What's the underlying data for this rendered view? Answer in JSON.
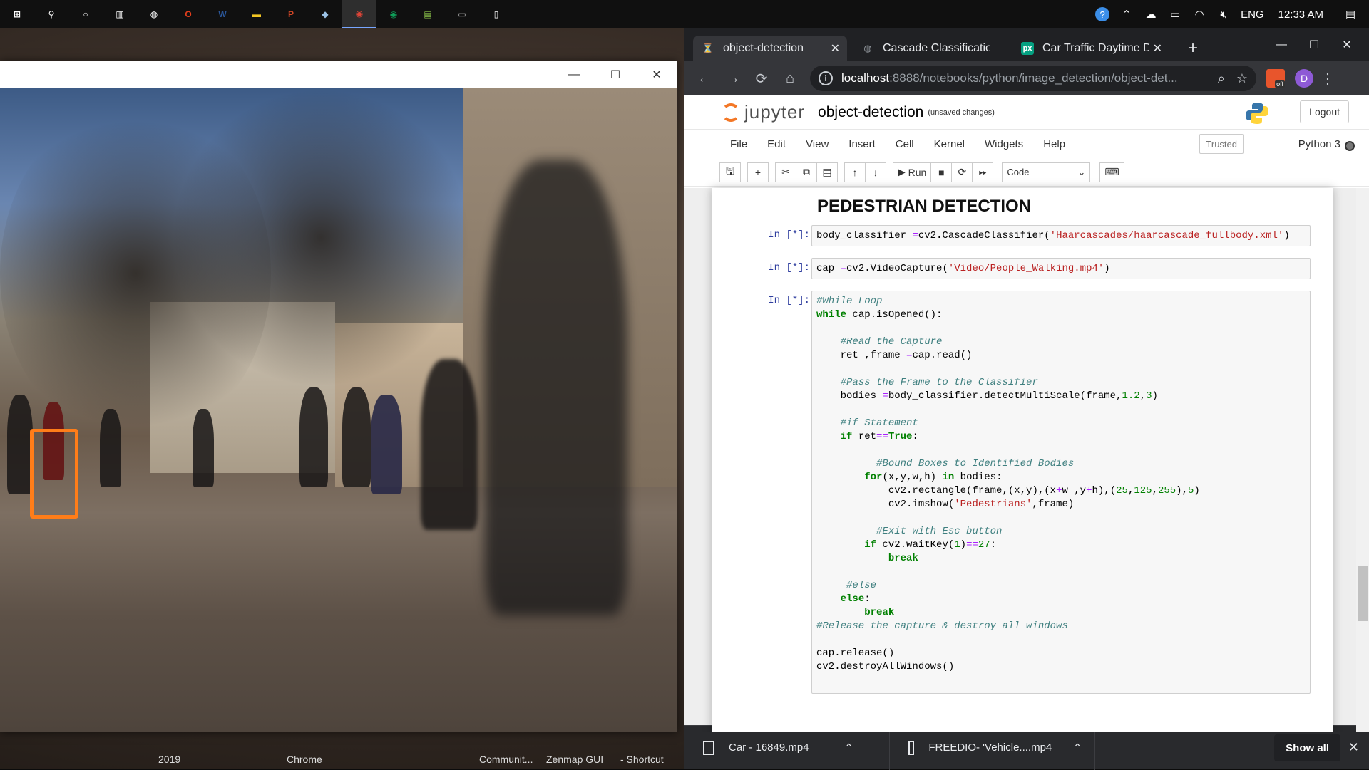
{
  "taskbar": {
    "apps": [
      {
        "name": "start",
        "glyph": "⊞",
        "color": "#ffffff"
      },
      {
        "name": "search",
        "glyph": "⚲",
        "color": "#ffffff"
      },
      {
        "name": "cortana",
        "glyph": "○",
        "color": "#ffffff"
      },
      {
        "name": "task-view",
        "glyph": "▥",
        "color": "#ffffff"
      },
      {
        "name": "app-mail",
        "glyph": "◍",
        "color": "#ffffff"
      },
      {
        "name": "office",
        "glyph": "O",
        "color": "#e43e1c"
      },
      {
        "name": "word",
        "glyph": "W",
        "color": "#2b579a"
      },
      {
        "name": "file-explorer",
        "glyph": "▬",
        "color": "#f3c623"
      },
      {
        "name": "powerpoint",
        "glyph": "P",
        "color": "#d24726"
      },
      {
        "name": "notes",
        "glyph": "◆",
        "color": "#9cc3e6"
      },
      {
        "name": "chrome",
        "glyph": "◉",
        "color": "#db4437"
      },
      {
        "name": "chrome-2",
        "glyph": "◉",
        "color": "#0f9d58"
      },
      {
        "name": "notepad-plus",
        "glyph": "▤",
        "color": "#8bc34a"
      },
      {
        "name": "terminal",
        "glyph": "▭",
        "color": "#d0d0d0"
      },
      {
        "name": "document",
        "glyph": "▯",
        "color": "#ffffff"
      }
    ],
    "tray": {
      "language": "ENG",
      "time": "12:33 AM"
    }
  },
  "desktop": {
    "labels": [
      "2019",
      "Chrome",
      "Communit...",
      "Zenmap GUI",
      "- Shortcut"
    ]
  },
  "video_window": {
    "minimize": "—",
    "maximize": "☐",
    "close": "✕"
  },
  "chrome": {
    "tabs": [
      {
        "title": "object-detection",
        "icon": "⏳",
        "icon_color": "#f37726",
        "active": true
      },
      {
        "title": "Cascade Classificatior",
        "icon": "◍",
        "icon_color": "#9aa0a6",
        "active": false
      },
      {
        "title": "Car Traffic Daytime D",
        "icon": "px",
        "icon_color": "#05a081",
        "active": false
      }
    ],
    "new_tab": "+",
    "url_host": "localhost",
    "url_path": ":8888/notebooks/python/image_detection/object-det...",
    "profile_initial": "D",
    "extension_badge": "off"
  },
  "jupyter": {
    "brand": "jupyter",
    "notebook_name": "object-detection",
    "status": "(unsaved changes)",
    "logout": "Logout",
    "menu": [
      "File",
      "Edit",
      "View",
      "Insert",
      "Cell",
      "Kernel",
      "Widgets",
      "Help"
    ],
    "trusted": "Trusted",
    "kernel": "Python 3",
    "run_label": "Run",
    "cell_type": "Code",
    "heading": "PEDESTRIAN DETECTION",
    "cells": [
      {
        "prompt": "In [*]:"
      },
      {
        "prompt": "In [*]:"
      },
      {
        "prompt": "In [*]:"
      }
    ]
  },
  "downloads": {
    "items": [
      {
        "name": "Car - 16849.mp4"
      },
      {
        "name": "FREEDIO- 'Vehicle....mp4"
      }
    ],
    "show_all": "Show all"
  }
}
